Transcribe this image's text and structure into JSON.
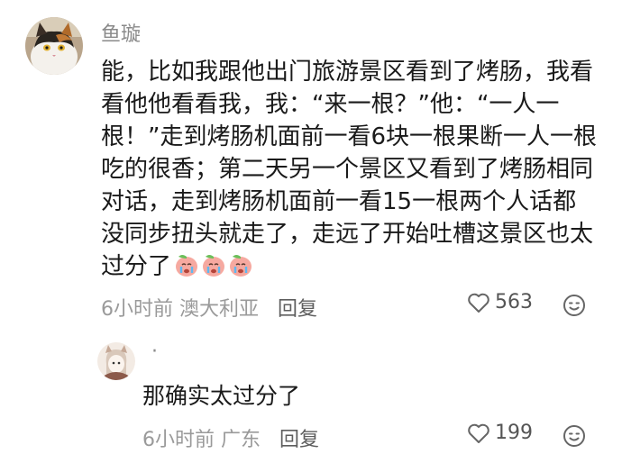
{
  "comment": {
    "author": "鱼璇",
    "text": "能，比如我跟他出门旅游景区看到了烤肠，我看看他他看看我，我：“来一根？”他：“一人一根！”走到烤肠机面前一看6块一根果断一人一根吃的很香；第二天另一个景区又看到了烤肠相同对话，走到烤肠机面前一看15一根两个人话都没同步扭头就走了，走远了开始吐槽这景区也太过分了",
    "emoji_icons": [
      "crying-peach-icon",
      "crying-peach-icon",
      "crying-peach-icon"
    ],
    "time": "6小时前",
    "location": "澳大利亚",
    "reply_label": "回复",
    "likes": "563"
  },
  "reply": {
    "author": "·",
    "text": "那确实太过分了",
    "time": "6小时前",
    "location": "广东",
    "reply_label": "回复",
    "likes": "199"
  }
}
